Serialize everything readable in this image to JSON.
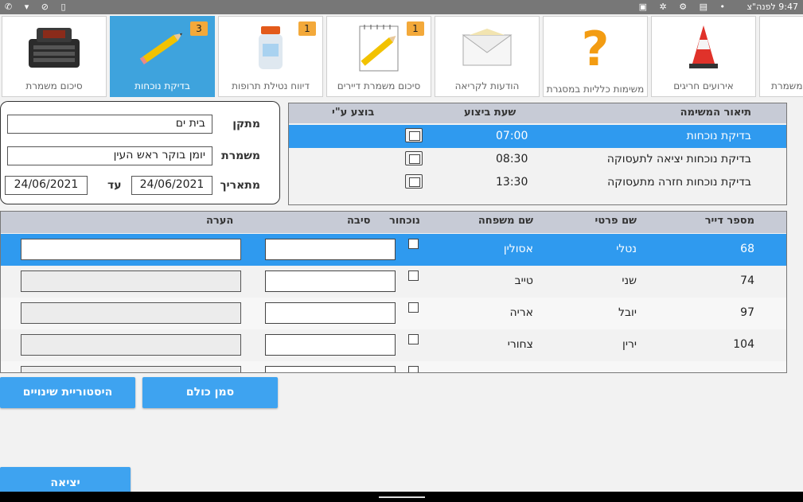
{
  "status_bar": {
    "time": "9:47 לפנה\"צ",
    "right_icons": "▣ ✲ ⚙ ▤ •",
    "left_icons": "✆ ▾ ⊘ ▯"
  },
  "tiles": [
    {
      "label": "סיכום משמרת",
      "badge": "",
      "icon": "console-icon"
    },
    {
      "label": "בדיקת נוכחות",
      "badge": "3",
      "icon": "pencil-icon"
    },
    {
      "label": "דיווח נטילת תרופות",
      "badge": "1",
      "icon": "pill-bottle-icon"
    },
    {
      "label": "סיכום משמרת דיירים",
      "badge": "1",
      "icon": "notepad-pencil-icon"
    },
    {
      "label": "הודעות לקריאה",
      "badge": "",
      "icon": "envelope-icon"
    },
    {
      "label": "משימות כלליות במסגרת",
      "badge": "",
      "icon": "question-mark-icon"
    },
    {
      "label": "אירועים חריגים",
      "badge": "",
      "icon": "traffic-cone-icon"
    },
    {
      "label": "משמרת",
      "badge": "",
      "icon": "partial-icon"
    }
  ],
  "filter": {
    "facility_label": "מתקן",
    "facility_value": "בית ים",
    "shift_label": "משמרת",
    "shift_value": "יומן בוקר ראש העין",
    "from_label": "מתאריך",
    "from_value": "24/06/2021",
    "to_label": "עד",
    "to_value": "24/06/2021"
  },
  "tasks": {
    "headers": {
      "desc": "תיאור המשימה",
      "time": "שעת ביצוע",
      "by": "בוצע ע\"י"
    },
    "rows": [
      {
        "desc": "בדיקת נוכחות",
        "time": "07:00"
      },
      {
        "desc": "בדיקת נוכחות יציאה לתעסוקה",
        "time": "08:30"
      },
      {
        "desc": "בדיקת נוכחות חזרה מתעסוקה",
        "time": "13:30"
      }
    ]
  },
  "residents": {
    "headers": {
      "num": "מספר דייר",
      "fname": "שם פרטי",
      "lname": "שם משפחה",
      "absent": "נוכחור",
      "reason": "סיבה",
      "note": "הערה"
    },
    "rows": [
      {
        "num": "68",
        "fname": "נטלי",
        "lname": "אסולין"
      },
      {
        "num": "74",
        "fname": "שני",
        "lname": "טייב"
      },
      {
        "num": "97",
        "fname": "יובל",
        "lname": "אריה"
      },
      {
        "num": "104",
        "fname": "ירין",
        "lname": "צחורי"
      }
    ]
  },
  "buttons": {
    "history": "היסטוריית שינויים",
    "mark_all": "סמן כולם",
    "exit": "יציאה"
  },
  "colors": {
    "accent": "#3ea3f0",
    "selected_row": "#2f9aef",
    "badge": "#f3a93a",
    "header": "#c7cbd6"
  }
}
